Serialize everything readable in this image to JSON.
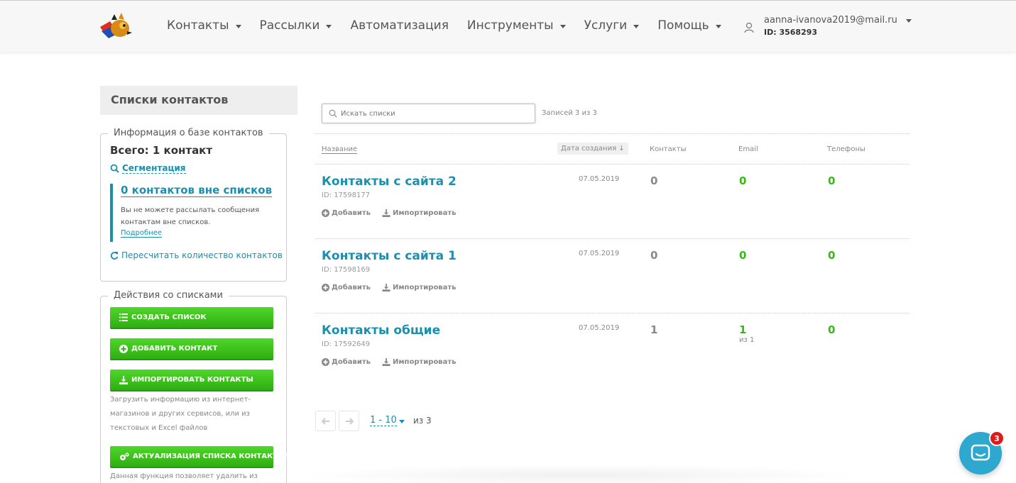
{
  "nav": {
    "items": [
      {
        "label": "Контакты",
        "dropdown": true
      },
      {
        "label": "Рассылки",
        "dropdown": true
      },
      {
        "label": "Автоматизация",
        "dropdown": false
      },
      {
        "label": "Инструменты",
        "dropdown": true
      },
      {
        "label": "Услуги",
        "dropdown": true
      },
      {
        "label": "Помощь",
        "dropdown": true
      }
    ],
    "user_email": "aanna-ivanova2019@mail.ru",
    "user_id": "ID: 3568293"
  },
  "sidebar": {
    "title": "Списки контактов",
    "info": {
      "legend": "Информация о базе контактов",
      "total": "Всего: 1 контакт",
      "segmentation": "Сегментация",
      "outside_title": "0 контактов вне списков",
      "outside_text": "Вы не можете рассылать сообщения контактам вне списков.",
      "more_link": "Подробнее",
      "recount": "Пересчитать количество контактов"
    },
    "actions": {
      "legend": "Действия со списками",
      "create": "СОЗДАТЬ СПИСОК",
      "add_contact": "ДОБАВИТЬ КОНТАКТ",
      "import": "ИМПОРТИРОВАТЬ КОНТАКТЫ",
      "import_note": "Загрузить информацию из интернет-магазинов и других сервисов, или из текстовых и Excel файлов",
      "actualize": "АКТУАЛИЗАЦИЯ СПИСКА КОНТАКТОВ",
      "actualize_note": "Данная функция позволяет удалить из базы"
    }
  },
  "main": {
    "search_placeholder": "Искать списки",
    "records": "Записей 3 из 3",
    "columns": {
      "name": "Название",
      "date": "Дата создания ↓",
      "contacts": "Контакты",
      "email": "Email",
      "phones": "Телефоны"
    },
    "add_label": "Добавить",
    "import_label": "Импортировать",
    "rows": [
      {
        "title": "Контакты с сайта 2",
        "id": "ID: 17598177",
        "date": "07.05.2019",
        "contacts": "0",
        "email": "0",
        "email_note": "",
        "phones": "0"
      },
      {
        "title": "Контакты с сайта 1",
        "id": "ID: 17598169",
        "date": "07.05.2019",
        "contacts": "0",
        "email": "0",
        "email_note": "",
        "phones": "0"
      },
      {
        "title": "Контакты общие",
        "id": "ID: 17592649",
        "date": "07.05.2019",
        "contacts": "1",
        "email": "1",
        "email_note": "из 1",
        "phones": "0"
      }
    ],
    "pagination": {
      "range": "1 - 10",
      "of": "из 3"
    }
  },
  "chat": {
    "badge": "3"
  },
  "colors": {
    "accent": "#1a8fb0",
    "green": "#33bb11",
    "badge": "#e01a1a"
  }
}
